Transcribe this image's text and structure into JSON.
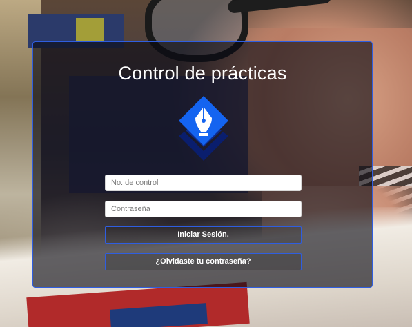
{
  "login": {
    "title": "Control de prácticas",
    "logo_icon": "pen-nib-diamond-icon",
    "control_number": {
      "value": "",
      "placeholder": "No. de control"
    },
    "password": {
      "value": "",
      "placeholder": "Contraseña"
    },
    "login_button_label": "Iniciar Sesión.",
    "forgot_password_label": "¿Olvidaste tu contraseña?"
  },
  "colors": {
    "accent_border": "#2f5ee0",
    "logo_blue": "#1464f0",
    "logo_navy": "#0a1e6e",
    "panel_background": "rgba(10,10,20,0.62)"
  }
}
